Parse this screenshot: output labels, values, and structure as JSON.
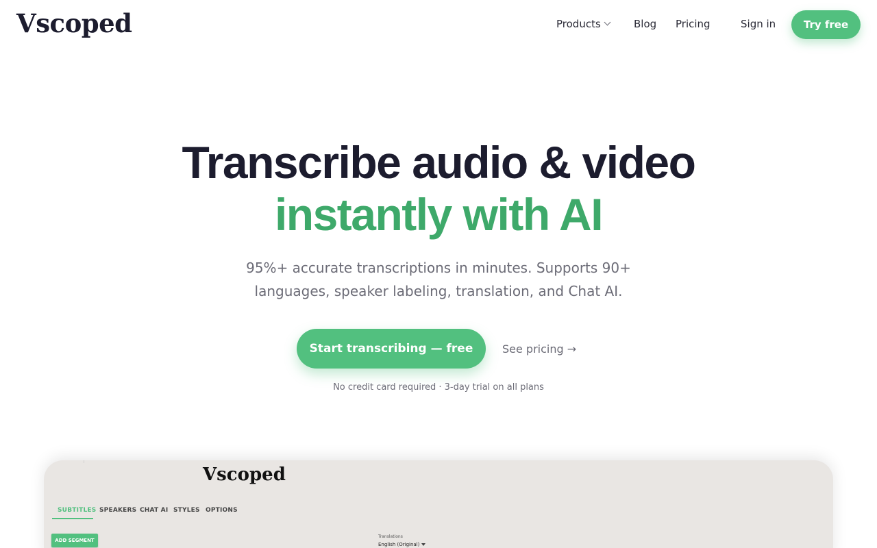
{
  "nav": {
    "logo": "Vscoped",
    "products": "Products",
    "blog": "Blog",
    "pricing": "Pricing",
    "sign_in": "Sign in",
    "try_free": "Try free"
  },
  "hero": {
    "title_line1": "Transcribe audio & video",
    "title_line2": "instantly with AI",
    "subtitle": "95%+ accurate transcriptions in minutes. Supports 90+ languages, speaker labeling, translation, and Chat AI.",
    "cta_primary": "Start transcribing — free",
    "cta_secondary": "See pricing →",
    "note": "No credit card required · 3-day trial on all plans"
  },
  "preview": {
    "logo": "Vscoped",
    "tabs": [
      "SUBTITLES",
      "SPEAKERS",
      "CHAT AI",
      "STYLES",
      "OPTIONS"
    ],
    "add_segment": "ADD SEGMENT",
    "translations_label": "Translations",
    "translations_value": "English (Original)"
  },
  "colors": {
    "brand_green": "#52c07f",
    "headline_green": "#3ea96a",
    "text_dark": "#1c1c2e",
    "text_muted": "#6b6b76"
  }
}
